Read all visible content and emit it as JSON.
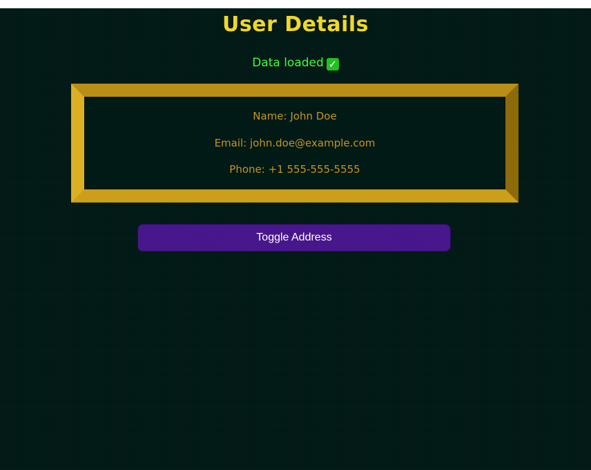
{
  "header": {
    "title": "User Details"
  },
  "status": {
    "text": "Data loaded",
    "check_glyph": "✓",
    "color": "#3dff3d"
  },
  "user": {
    "name_line": "Name: John Doe",
    "email_line": "Email: john.doe@example.com",
    "phone_line": "Phone: +1 555-555-5555"
  },
  "actions": {
    "toggle_address_label": "Toggle Address"
  },
  "colors": {
    "background": "#011a16",
    "title": "#f0d72a",
    "card_border": "#c9a020",
    "card_text": "#c6951e",
    "button": "#45148a"
  }
}
